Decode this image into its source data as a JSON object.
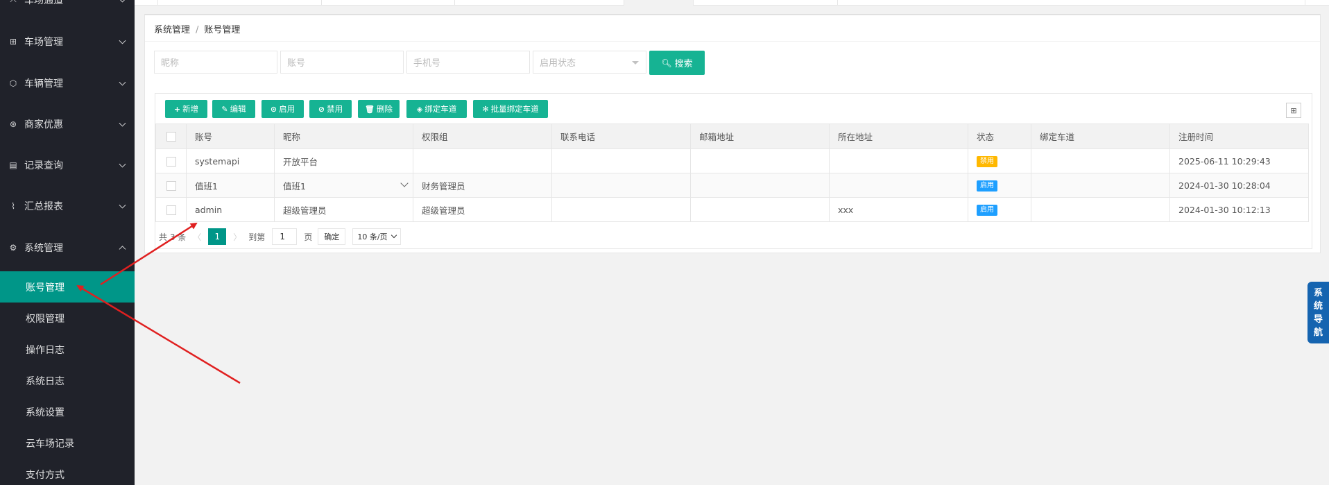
{
  "sidebar": {
    "items": [
      {
        "label": "车场通道",
        "icon": "road-icon"
      },
      {
        "label": "车场管理",
        "icon": "grid-icon"
      },
      {
        "label": "车辆管理",
        "icon": "cube-icon"
      },
      {
        "label": "商家优惠",
        "icon": "coupon-icon"
      },
      {
        "label": "记录查询",
        "icon": "document-icon"
      },
      {
        "label": "汇总报表",
        "icon": "chart-icon"
      },
      {
        "label": "系统管理",
        "icon": "gear-icon"
      }
    ],
    "submenu": [
      {
        "label": "账号管理",
        "active": true
      },
      {
        "label": "权限管理"
      },
      {
        "label": "操作日志"
      },
      {
        "label": "系统日志"
      },
      {
        "label": "系统设置"
      },
      {
        "label": "云车场记录"
      },
      {
        "label": "支付方式"
      }
    ]
  },
  "breadcrumb": {
    "parent": "系统管理",
    "separator": "/",
    "current": "账号管理"
  },
  "search": {
    "nickname_placeholder": "昵称",
    "account_placeholder": "账号",
    "phone_placeholder": "手机号",
    "status_placeholder": "启用状态",
    "search_label": "搜索"
  },
  "toolbar": {
    "add": "新增",
    "edit": "编辑",
    "enable": "启用",
    "disable": "禁用",
    "delete": "删除",
    "bind_lane": "绑定车道",
    "batch_bind_lane": "批量绑定车道"
  },
  "table": {
    "headers": [
      "账号",
      "昵称",
      "权限组",
      "联系电话",
      "邮箱地址",
      "所在地址",
      "状态",
      "绑定车道",
      "注册时间"
    ],
    "rows": [
      {
        "account": "systemapi",
        "nickname": "开放平台",
        "role": "",
        "phone": "",
        "email": "",
        "address": "",
        "status": "禁用",
        "status_type": "disabled",
        "lane": "",
        "registered": "2025-06-11 10:29:43"
      },
      {
        "account": "值班1",
        "nickname": "值班1",
        "role": "财务管理员",
        "phone": "",
        "email": "",
        "address": "",
        "status": "启用",
        "status_type": "enabled",
        "lane": "",
        "registered": "2024-01-30 10:28:04"
      },
      {
        "account": "admin",
        "nickname": "超级管理员",
        "role": "超级管理员",
        "phone": "",
        "email": "",
        "address": "xxx",
        "status": "启用",
        "status_type": "enabled",
        "lane": "",
        "registered": "2024-01-30 10:12:13"
      }
    ]
  },
  "pager": {
    "total": "共 3 条",
    "current": "1",
    "goto_label": "到第",
    "goto_value": "1",
    "page_unit": "页",
    "confirm": "确定",
    "page_size": "10 条/页"
  },
  "float_nav": {
    "label": "系统导航"
  },
  "colors": {
    "primary": "#16b393",
    "active_menu": "#009688",
    "sidebar_bg": "#20222a",
    "badge_disabled": "#ffb800",
    "badge_enabled": "#1e9fff",
    "float_nav": "#1564b0",
    "annotation": "#e02020"
  }
}
